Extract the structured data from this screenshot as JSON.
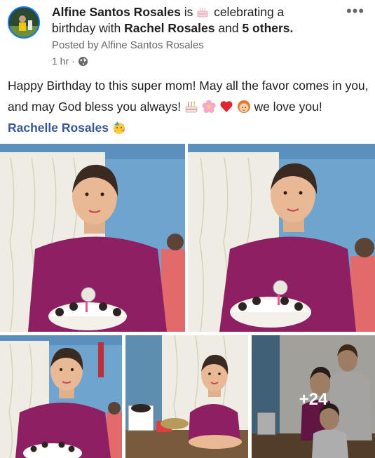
{
  "post": {
    "author": "Alfine Santos Rosales",
    "is_text": "is",
    "activity": "celebrating a birthday with",
    "tagged_name": "Rachel Rosales",
    "and_text": "and",
    "others": "5 others",
    "period": ".",
    "posted_by": "Posted by Alfine Santos Rosales",
    "time": "1 hr",
    "dot": "·",
    "audience_icon": "globe-icon",
    "more_icon": "more-options-icon",
    "more_label": "•••"
  },
  "body": {
    "line_part1": "Happy Birthday to this super mom! May all the favor comes in you, and may God bless you always!",
    "line_part2": "we love you!",
    "mention": "Rachelle Rosales",
    "emojis": [
      "birthday-cake-emoji",
      "cherry-blossom-emoji",
      "red-heart-emoji",
      "woman-emoji",
      "partying-face-emoji"
    ]
  },
  "photos": {
    "count": 5,
    "extra_count_label": "+24"
  },
  "colors": {
    "link": "#385898",
    "meta": "#65676b",
    "text": "#1c1e21",
    "shirt": "#8e1f63"
  }
}
